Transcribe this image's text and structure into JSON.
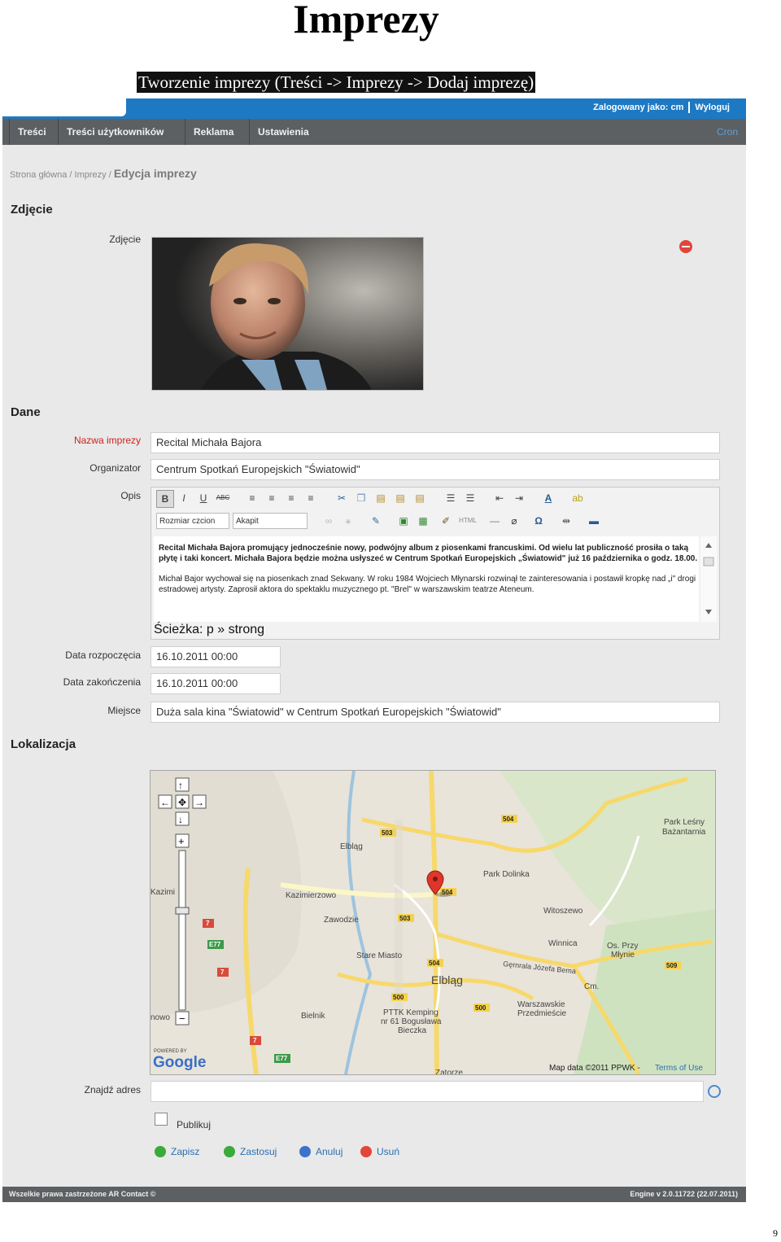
{
  "document": {
    "title": "Imprezy",
    "subtitle": "Tworzenie imprezy (Treści -> Imprezy -> Dodaj imprezę)",
    "page_number": "9"
  },
  "topbar": {
    "logged_in_as": "Zalogowany jako: cm",
    "logout": "Wyloguj"
  },
  "menu": {
    "items": [
      "Treści",
      "Treści użytkowników",
      "Reklama",
      "Ustawienia"
    ],
    "cron": "Cron"
  },
  "breadcrumb": {
    "home": "Strona główna",
    "separator": "/",
    "section": "Imprezy",
    "current": "Edycja imprezy"
  },
  "photo_section": {
    "heading": "Zdjęcie",
    "label": "Zdjęcie",
    "remove_icon": "remove-icon"
  },
  "data_section": {
    "heading": "Dane",
    "name_label": "Nazwa imprezy",
    "name_value": "Recital Michała Bajora",
    "organizer_label": "Organizator",
    "organizer_value": "Centrum Spotkań Europejskich \"Światowid\"",
    "description_label": "Opis",
    "start_label": "Data rozpoczęcia",
    "start_value": "16.10.2011 00:00",
    "end_label": "Data zakończenia",
    "end_value": "16.10.2011 00:00",
    "place_label": "Miejsce",
    "place_value": "Duża sala kina \"Światowid\" w Centrum Spotkań Europejskich \"Światowid\""
  },
  "editor": {
    "font_size_select": "Rozmiar czcion",
    "format_select": "Akapit",
    "html_button": "HTML",
    "omega_button": "Ω",
    "bold": "B",
    "italic": "I",
    "underline": "U",
    "strike": "ABC",
    "paragraph1": "Recital Michała Bajora promujący jednocześnie nowy, podwójny album z piosenkami francuskimi. Od wielu lat publiczność prosiła o taką płytę i taki koncert. Michała Bajora będzie można usłyszeć w Centrum Spotkań Europejskich „Światowid\" już 16 października o godz. 18.00.",
    "paragraph2": "Michał Bajor wychował się na piosenkach znad Sekwany. W roku 1984 Wojciech Młynarski rozwinął te zainteresowania i postawił kropkę nad „i\" drogi estradowej artysty. Zaprosił aktora do spektaklu muzycznego pt. \"Brel\" w warszawskim teatrze Ateneum.",
    "path": "Ścieżka: p » strong"
  },
  "location_section": {
    "heading": "Lokalizacja",
    "map_labels": [
      "Elbląg",
      "Kazimierzowo",
      "Zawodzie",
      "Stare Miasto",
      "Park Dolinka",
      "Witoszewo",
      "Winnica",
      "Os. Przy Młynie",
      "Gęrnrala Józefa Bema",
      "Cm.",
      "Warszawskie Przedmieście",
      "PTTK Kemping nr 61 Bogusława Bieczka",
      "Bielnik",
      "Park Leśny Bażantarnia",
      "Zatorze",
      "Kazimierzowo",
      "nowo"
    ],
    "road_numbers": [
      "503",
      "504",
      "504",
      "503",
      "504",
      "500",
      "500",
      "509",
      "7",
      "7",
      "7",
      "E77",
      "E77"
    ],
    "copyright": "Map data ©2011 PPWK - ",
    "terms": "Terms of Use",
    "powered_by": "POWERED BY",
    "google": "Google",
    "find_address_label": "Znajdź adres",
    "find_address_value": ""
  },
  "publish": {
    "label": "Publikuj",
    "checked": false
  },
  "actions": {
    "save": "Zapisz",
    "apply": "Zastosuj",
    "cancel": "Anuluj",
    "delete": "Usuń"
  },
  "footer": {
    "left": "Wszelkie prawa zastrzeżone AR Contact ©",
    "right": "Engine v 2.0.11722 (22.07.2011)"
  },
  "colors": {
    "topbar": "#1d79c3",
    "menubar": "#5d6063",
    "required_label": "#d0211f",
    "link": "#2a6fb0"
  }
}
